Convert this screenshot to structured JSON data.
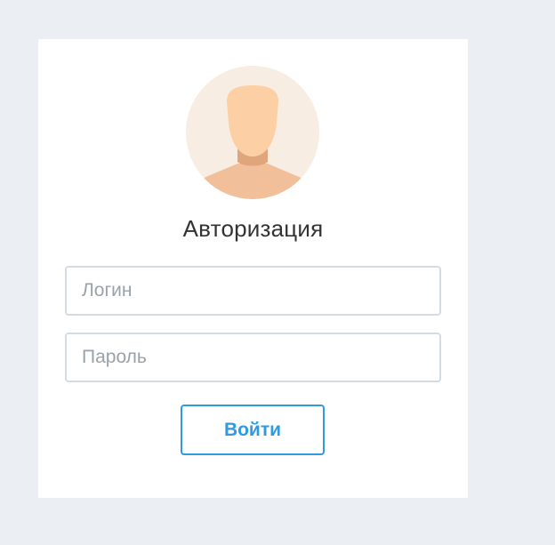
{
  "login_form": {
    "title": "Авторизация",
    "login": {
      "value": "",
      "placeholder": "Логин"
    },
    "password": {
      "value": "",
      "placeholder": "Пароль"
    },
    "submit_label": "Войти"
  },
  "avatar": {
    "icon": "user-avatar-icon",
    "colors": {
      "background": "#f7ede3",
      "face": "#fccfa4",
      "shoulders": "#f1bf9a",
      "neck_shadow": "#dfa67c"
    }
  },
  "colors": {
    "page_background": "#ebeef3",
    "card_background": "#ffffff",
    "accent": "#2f9ae0",
    "field_border": "#d3dce5",
    "text": "#333333",
    "placeholder": "#9aa2a9"
  }
}
